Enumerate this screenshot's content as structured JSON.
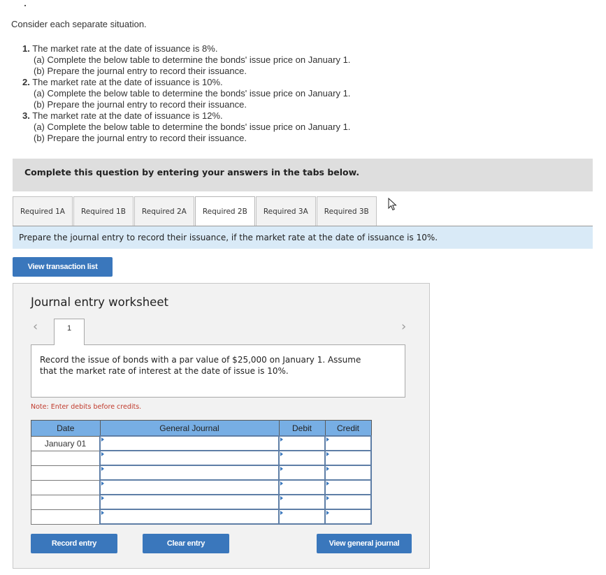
{
  "intro": "Consider each separate situation.",
  "situations": [
    {
      "number": "1.",
      "text": "The market rate at the date of issuance is 8%.",
      "parts": [
        "(a) Complete the below table to determine the bonds' issue price on January 1.",
        "(b) Prepare the journal entry to record their issuance."
      ]
    },
    {
      "number": "2.",
      "text": "The market rate at the date of issuance is 10%.",
      "parts": [
        "(a) Complete the below table to determine the bonds' issue price on January 1.",
        "(b) Prepare the journal entry to record their issuance."
      ]
    },
    {
      "number": "3.",
      "text": "The market rate at the date of issuance is 12%.",
      "parts": [
        "(a) Complete the below table to determine the bonds' issue price on January 1.",
        "(b) Prepare the journal entry to record their issuance."
      ]
    }
  ],
  "banner": "Complete this question by entering your answers in the tabs below.",
  "tabs": [
    {
      "label": "Required 1A",
      "active": false
    },
    {
      "label": "Required 1B",
      "active": false
    },
    {
      "label": "Required 2A",
      "active": false
    },
    {
      "label": "Required 2B",
      "active": true
    },
    {
      "label": "Required 3A",
      "active": false
    },
    {
      "label": "Required 3B",
      "active": false
    }
  ],
  "instruction": "Prepare the journal entry to record their issuance, if the market rate at the date of issuance is 10%.",
  "buttons": {
    "view_transaction_list": "View transaction list",
    "record_entry": "Record entry",
    "clear_entry": "Clear entry",
    "view_general_journal": "View general journal"
  },
  "worksheet": {
    "title": "Journal entry worksheet",
    "prev_icon": "‹",
    "next_icon": "›",
    "entry_tab": "1",
    "description": "Record the issue of bonds with a par value of $25,000 on January 1. Assume that the market rate of interest at the date of issue is 10%.",
    "note": "Note: Enter debits before credits.",
    "table": {
      "headers": [
        "Date",
        "General Journal",
        "Debit",
        "Credit"
      ],
      "rows": [
        {
          "date": "January 01",
          "account": "",
          "debit": "",
          "credit": ""
        },
        {
          "date": "",
          "account": "",
          "debit": "",
          "credit": ""
        },
        {
          "date": "",
          "account": "",
          "debit": "",
          "credit": ""
        },
        {
          "date": "",
          "account": "",
          "debit": "",
          "credit": ""
        },
        {
          "date": "",
          "account": "",
          "debit": "",
          "credit": ""
        },
        {
          "date": "",
          "account": "",
          "debit": "",
          "credit": ""
        }
      ]
    }
  },
  "colors": {
    "button_blue": "#3a77bc",
    "table_header": "#77aee4",
    "instruction_bg": "#d9eaf7",
    "banner_bg": "#dedede",
    "note_red": "#c0392b"
  }
}
